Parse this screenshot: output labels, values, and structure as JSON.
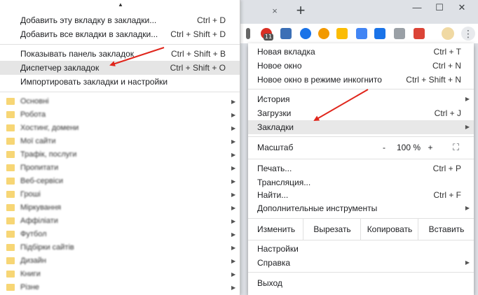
{
  "browser": {
    "tab_close_glyph": "×",
    "new_tab_glyph": "+",
    "window_controls": {
      "minimize": "—",
      "maximize": "☐",
      "close": "✕"
    },
    "extension_badge": "11",
    "menu_glyph": "⋮"
  },
  "bookmarks_submenu": {
    "items": [
      {
        "label": "Добавить эту вкладку в закладки...",
        "shortcut": "Ctrl + D"
      },
      {
        "label": "Добавить все вкладки в закладки...",
        "shortcut": "Ctrl + Shift + D"
      },
      {
        "label": "Показывать панель закладок",
        "shortcut": "Ctrl + Shift + B"
      },
      {
        "label": "Диспетчер закладок",
        "shortcut": "Ctrl + Shift + O"
      },
      {
        "label": "Импортировать закладки и настройки",
        "shortcut": ""
      }
    ],
    "folders": [
      "Основні",
      "Робота",
      "Хостинг, домени",
      "Мої сайти",
      "Трафік, послуги",
      "Пропитати",
      "Веб-сервіси",
      "Гроші",
      "Міркування",
      "Аффіліати",
      "Футбол",
      "Підбірки сайтів",
      "Дизайн",
      "Книги",
      "Різне"
    ]
  },
  "main_menu": {
    "new_tab": {
      "label": "Новая вкладка",
      "shortcut": "Ctrl + T"
    },
    "new_window": {
      "label": "Новое окно",
      "shortcut": "Ctrl + N"
    },
    "incognito": {
      "label": "Новое окно в режиме инкогнито",
      "shortcut": "Ctrl + Shift + N"
    },
    "history": {
      "label": "История"
    },
    "downloads": {
      "label": "Загрузки",
      "shortcut": "Ctrl + J"
    },
    "bookmarks": {
      "label": "Закладки"
    },
    "zoom": {
      "label": "Масштаб",
      "minus": "-",
      "value": "100 %",
      "plus": "+",
      "fullscreen": "⛶"
    },
    "print": {
      "label": "Печать...",
      "shortcut": "Ctrl + P"
    },
    "cast": {
      "label": "Трансляция..."
    },
    "find": {
      "label": "Найти...",
      "shortcut": "Ctrl + F"
    },
    "more_tools": {
      "label": "Дополнительные инструменты"
    },
    "edit": {
      "label": "Изменить",
      "cut": "Вырезать",
      "copy": "Копировать",
      "paste": "Вставить"
    },
    "settings": {
      "label": "Настройки"
    },
    "help": {
      "label": "Справка"
    },
    "exit": {
      "label": "Выход"
    }
  },
  "annotation_color": "#e0261c"
}
